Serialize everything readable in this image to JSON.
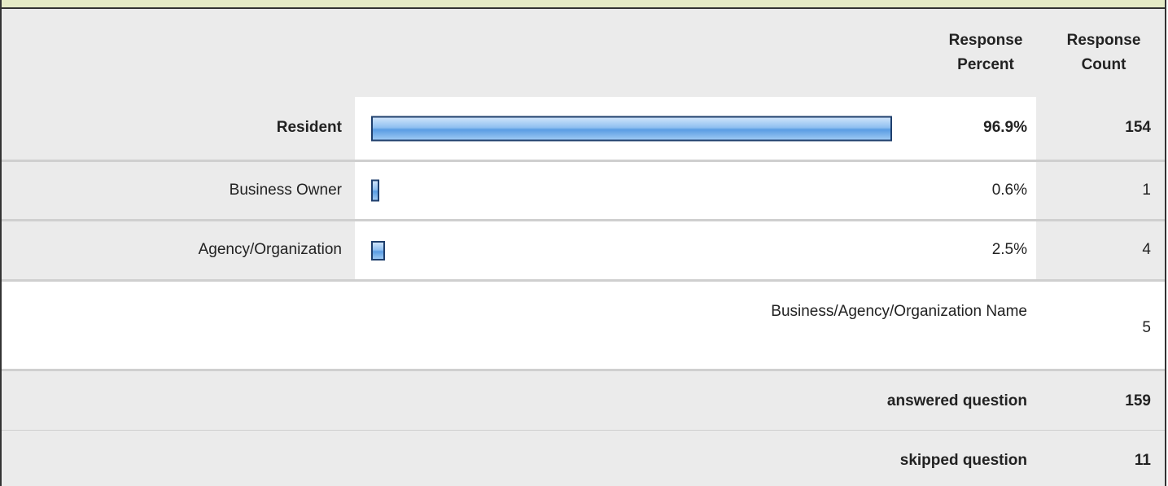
{
  "header": {
    "percent_label_line1": "Response",
    "percent_label_line2": "Percent",
    "count_label_line1": "Response",
    "count_label_line2": "Count"
  },
  "chart_data": {
    "type": "bar",
    "categories": [
      "Resident",
      "Business Owner",
      "Agency/Organization"
    ],
    "values": [
      96.9,
      0.6,
      2.5
    ],
    "percent_labels": [
      "96.9%",
      "0.6%",
      "2.5%"
    ],
    "counts": [
      "154",
      "1",
      "4"
    ],
    "bar_color": "#8fbff0",
    "bar_border_color": "#1f3f6d"
  },
  "other_field": {
    "label": "Business/Agency/Organization Name",
    "count": "5"
  },
  "summary": {
    "answered_label": "answered question",
    "answered_count": "159",
    "skipped_label": "skipped question",
    "skipped_count": "11"
  }
}
